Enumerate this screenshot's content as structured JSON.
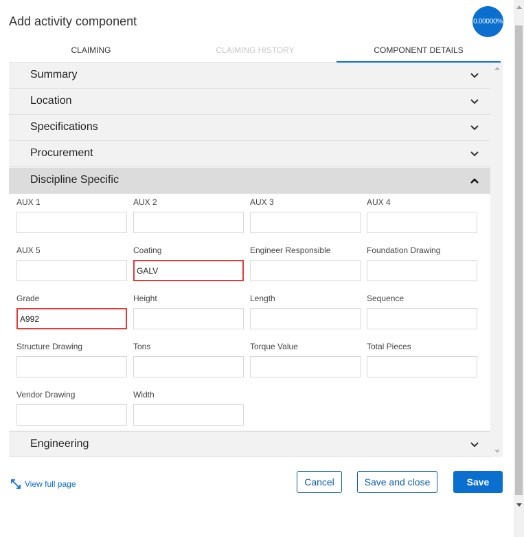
{
  "dialog": {
    "title": "Add activity component",
    "progress": "0.00000%"
  },
  "tabs": [
    {
      "label": "CLAIMING",
      "state": "normal"
    },
    {
      "label": "CLAIMING HISTORY",
      "state": "disabled"
    },
    {
      "label": "COMPONENT DETAILS",
      "state": "active"
    }
  ],
  "sections": {
    "summary": "Summary",
    "location": "Location",
    "specifications": "Specifications",
    "procurement": "Procurement",
    "discipline": "Discipline Specific",
    "engineering": "Engineering"
  },
  "fields": {
    "aux1": {
      "label": "AUX 1",
      "value": ""
    },
    "aux2": {
      "label": "AUX 2",
      "value": ""
    },
    "aux3": {
      "label": "AUX 3",
      "value": ""
    },
    "aux4": {
      "label": "AUX 4",
      "value": ""
    },
    "aux5": {
      "label": "AUX 5",
      "value": ""
    },
    "coating": {
      "label": "Coating",
      "value": "GALV"
    },
    "engineer": {
      "label": "Engineer Responsible",
      "value": ""
    },
    "foundation": {
      "label": "Foundation Drawing",
      "value": ""
    },
    "grade": {
      "label": "Grade",
      "value": "A992"
    },
    "height": {
      "label": "Height",
      "value": ""
    },
    "length": {
      "label": "Length",
      "value": ""
    },
    "sequence": {
      "label": "Sequence",
      "value": ""
    },
    "structure": {
      "label": "Structure Drawing",
      "value": ""
    },
    "tons": {
      "label": "Tons",
      "value": ""
    },
    "torque": {
      "label": "Torque Value",
      "value": ""
    },
    "pieces": {
      "label": "Total Pieces",
      "value": ""
    },
    "vendor": {
      "label": "Vendor Drawing",
      "value": ""
    },
    "width": {
      "label": "Width",
      "value": ""
    }
  },
  "footer": {
    "view_full": "View full page",
    "cancel": "Cancel",
    "save_close": "Save and close",
    "save": "Save"
  },
  "colors": {
    "accent": "#0b6fd0",
    "highlight": "#e03a3a"
  },
  "icons": [
    "chevron-down-icon",
    "chevron-up-icon",
    "expand-icon"
  ]
}
